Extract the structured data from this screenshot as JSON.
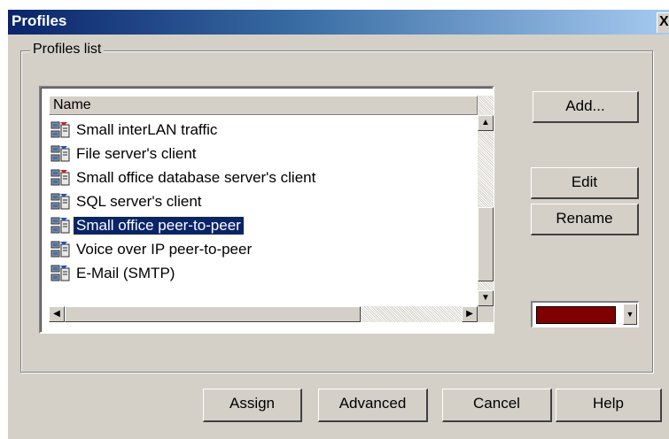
{
  "window": {
    "title": "Profiles",
    "close_glyph": "X"
  },
  "group": {
    "label": "Profiles list"
  },
  "list": {
    "column_header": "Name",
    "items": [
      {
        "label": "Small interLAN traffic",
        "icon": "network-profile-icon",
        "badge_color": "#cc2020"
      },
      {
        "label": "File server's client",
        "icon": "network-profile-icon",
        "badge_color": "#2050c0"
      },
      {
        "label": "Small office database server's client",
        "icon": "network-profile-icon",
        "badge_color": "#cc2020"
      },
      {
        "label": "SQL server's client",
        "icon": "network-profile-icon",
        "badge_color": "#2050c0"
      },
      {
        "label": "Small office peer-to-peer",
        "icon": "network-profile-icon",
        "badge_color": "#2050c0",
        "selected": true
      },
      {
        "label": "Voice over IP peer-to-peer",
        "icon": "network-profile-icon",
        "badge_color": "#2050c0"
      },
      {
        "label": "E-Mail (SMTP)",
        "icon": "network-profile-icon",
        "badge_color": "#2050c0"
      }
    ]
  },
  "side_buttons": {
    "add": {
      "label": "Add...",
      "mnemonic": "A"
    },
    "edit": {
      "label": "Edit",
      "mnemonic": "E"
    },
    "rename": {
      "label": "Rename",
      "mnemonic": "R"
    }
  },
  "color_picker": {
    "selected_color": "#800000"
  },
  "bottom_buttons": {
    "assign": {
      "label": "Assign"
    },
    "advanced": {
      "label": "Advanced"
    },
    "cancel": {
      "label": "Cancel"
    },
    "help": {
      "label": "Help"
    }
  },
  "colors": {
    "selection": "#0a246a",
    "face": "#d4d0c8"
  }
}
